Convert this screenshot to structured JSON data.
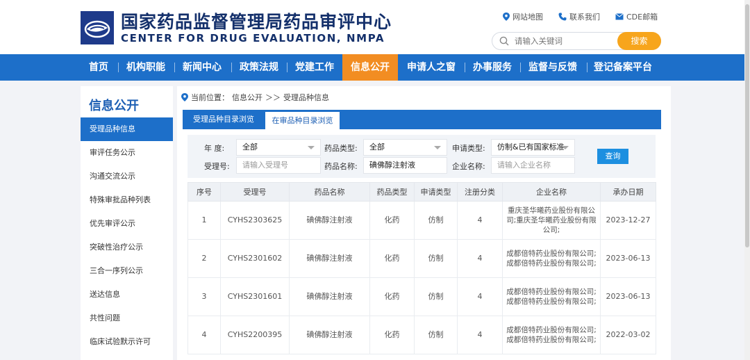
{
  "header": {
    "title_cn": "国家药品监督管理局药品审评中心",
    "title_en": "CENTER FOR DRUG EVALUATION, NMPA",
    "top_links": [
      {
        "label": "网站地图",
        "icon": "location-pin-icon"
      },
      {
        "label": "联系我们",
        "icon": "phone-icon"
      },
      {
        "label": "CDE邮箱",
        "icon": "mail-icon"
      }
    ],
    "search": {
      "placeholder": "请输入关键词",
      "button_label": "搜索"
    }
  },
  "nav": {
    "items": [
      {
        "label": "首页"
      },
      {
        "label": "机构职能"
      },
      {
        "label": "新闻中心"
      },
      {
        "label": "政策法规"
      },
      {
        "label": "党建工作"
      },
      {
        "label": "信息公开",
        "active": true
      },
      {
        "label": "申请人之窗"
      },
      {
        "label": "办事服务"
      },
      {
        "label": "监督与反馈"
      },
      {
        "label": "登记备案平台"
      }
    ]
  },
  "sidebar": {
    "title": "信息公开",
    "items": [
      {
        "label": "受理品种信息",
        "active": true
      },
      {
        "label": "审评任务公示"
      },
      {
        "label": "沟通交流公示"
      },
      {
        "label": "特殊审批品种列表"
      },
      {
        "label": "优先审评公示"
      },
      {
        "label": "突破性治疗公示"
      },
      {
        "label": "三合一序列公示"
      },
      {
        "label": "送达信息"
      },
      {
        "label": "共性问题"
      },
      {
        "label": "临床试验默示许可"
      }
    ]
  },
  "breadcrumb": {
    "prefix": "当前位置：",
    "level1": "信息公开",
    "sep": "＞＞",
    "level2": "受理品种信息"
  },
  "tabs": [
    {
      "label": "受理品种目录浏览"
    },
    {
      "label": "在审品种目录浏览",
      "active": true
    }
  ],
  "filters": {
    "year_label": "年    度:",
    "year_value": "全部",
    "drug_type_label": "药品类型:",
    "drug_type_value": "全部",
    "apply_type_label": "申请类型:",
    "apply_type_value": "仿制&已有国家标准",
    "accept_no_label": "受理号:",
    "accept_no_placeholder": "请输入受理号",
    "drug_name_label": "药品名称:",
    "drug_name_value": "碘佛醇注射液",
    "company_label": "企业名称:",
    "company_placeholder": "请输入企业名称",
    "query_label": "查询"
  },
  "table": {
    "headers": [
      "序号",
      "受理号",
      "药品名称",
      "药品类型",
      "申请类型",
      "注册分类",
      "企业名称",
      "承办日期"
    ],
    "rows": [
      [
        "1",
        "CYHS2303625",
        "碘佛醇注射液",
        "化药",
        "仿制",
        "4",
        "重庆圣华曦药业股份有限公司;重庆圣华曦药业股份有限公司;",
        "2023-12-27"
      ],
      [
        "2",
        "CYHS2301602",
        "碘佛醇注射液",
        "化药",
        "仿制",
        "4",
        "成都倍特药业股份有限公司;成都倍特药业股份有限公司;",
        "2023-06-13"
      ],
      [
        "3",
        "CYHS2301601",
        "碘佛醇注射液",
        "化药",
        "仿制",
        "4",
        "成都倍特药业股份有限公司;成都倍特药业股份有限公司;",
        "2023-06-13"
      ],
      [
        "4",
        "CYHS2200395",
        "碘佛醇注射液",
        "化药",
        "仿制",
        "4",
        "成都倍特药业股份有限公司;成都倍特药业股份有限公司;",
        "2022-03-02"
      ]
    ]
  },
  "colors": {
    "nav_blue": "#1d6fc9",
    "accent_orange": "#f28d22",
    "search_orange": "#f7a51c",
    "brand_navy": "#14306b"
  }
}
